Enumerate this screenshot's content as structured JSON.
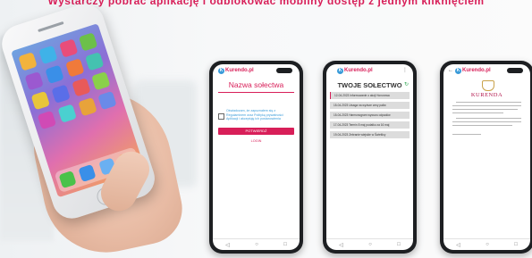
{
  "headline": "Wystarczy pobrać aplikację i odblokować mobilny dostęp z jednym kliknięciem",
  "brand_color": "#d81f59",
  "app_icon_colors": [
    "#f2b33d",
    "#3fb2e8",
    "#e84d7a",
    "#6cc04a",
    "#9b59d0",
    "#3a8fe8",
    "#f07a3a",
    "#44c2b0",
    "#e8c63a",
    "#5a6ee8",
    "#e85a5a",
    "#8ad04a",
    "#d04ab5",
    "#4ad0d0",
    "#e8a33a",
    "#6a8ae8"
  ],
  "dock_icon_colors": [
    "#4ac24a",
    "#3a8fe8",
    "#6ab0f2",
    "#f2a23a"
  ],
  "phone1": {
    "logo": "Kurendo.pl",
    "title": "Nazwa sołectwa",
    "consent_text": "Oświadczam, że zapoznałem się z Regulaminem oraz Polityką prywatności Aplikacji i akceptuję ich postanowienia",
    "confirm_button": "POTWIERDŹ",
    "link": "LOGIN",
    "nav": [
      "◁",
      "○",
      "□"
    ]
  },
  "phone2": {
    "logo": "Kurendo.pl",
    "menu": "⋮",
    "title": "TWOJE SOŁECTWO",
    "refresh": "↻",
    "items": [
      "12-04-2023   Informowanie o akcji Honorowa",
      "15-04-2023   Uwaga na wyższe ceny paliw",
      "15-04-2023   Harmonogram wywozu odpadów",
      "17-04-2023   Termin 8 maj podatku za 16 maj",
      "19-04-2023   Zebranie wiejskie w Świetlicy"
    ],
    "nav": [
      "◁",
      "○",
      "□"
    ]
  },
  "phone3": {
    "back": "←",
    "logo": "Kurendo.pl",
    "title": "KURENDA",
    "nav": [
      "◁",
      "○",
      "□"
    ]
  }
}
